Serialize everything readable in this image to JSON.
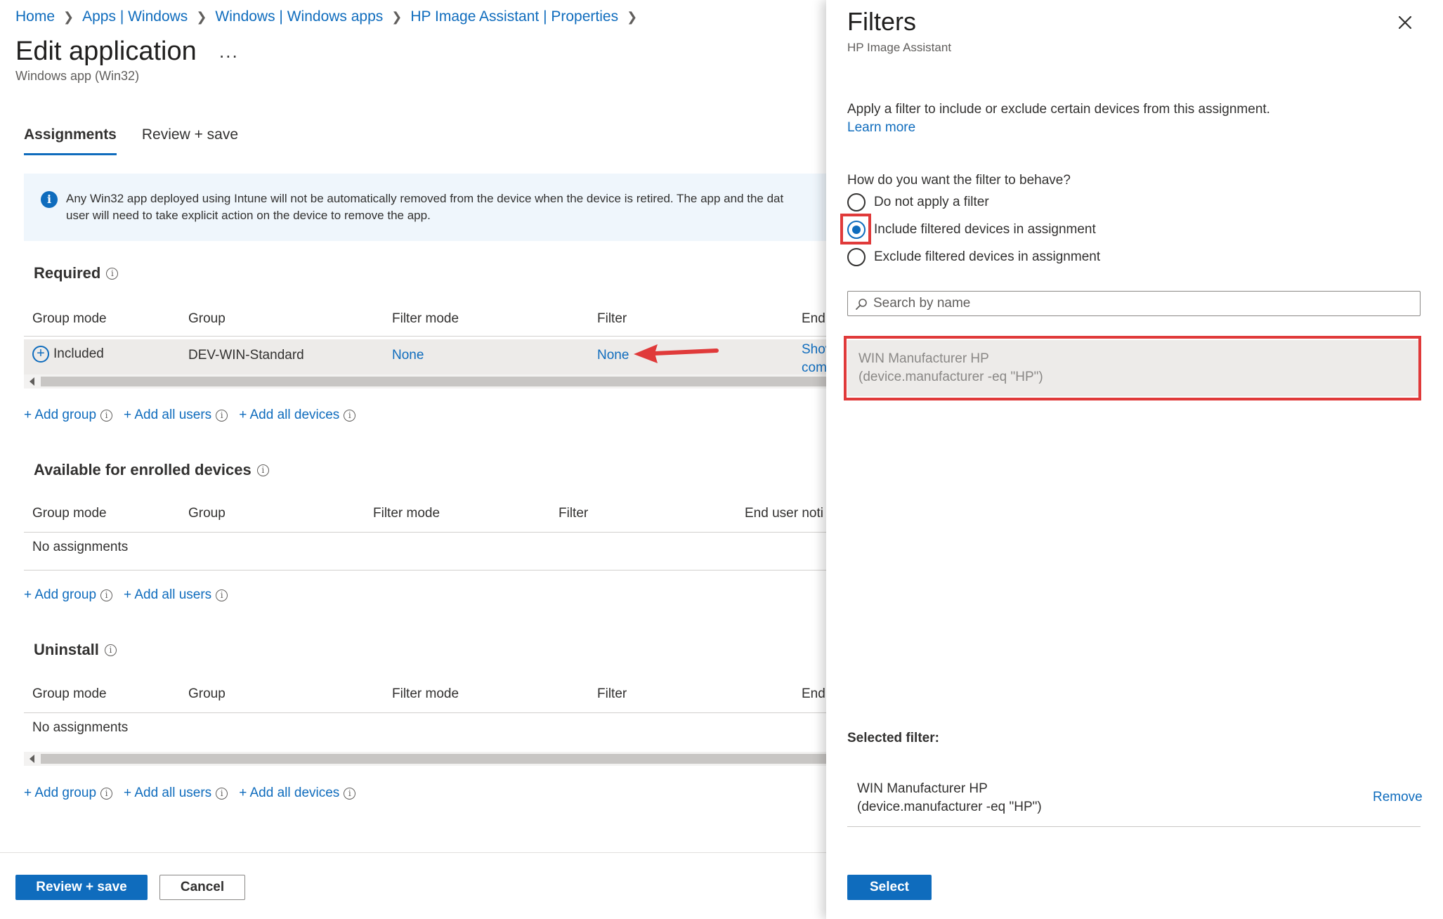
{
  "breadcrumb": [
    "Home",
    "Apps | Windows",
    "Windows | Windows apps",
    "HP Image Assistant | Properties"
  ],
  "page": {
    "title": "Edit application",
    "more_label": "...",
    "subtitle": "Windows app (Win32)"
  },
  "tabs": [
    "Assignments",
    "Review + save"
  ],
  "info_bar": {
    "line1": "Any Win32 app deployed using Intune will not be automatically removed from the device when the device is retired. The app and the dat",
    "line2": "user will need to take explicit action on the device to remove the app."
  },
  "required": {
    "title": "Required",
    "columns": [
      "Group mode",
      "Group",
      "Filter mode",
      "Filter",
      "End"
    ],
    "row": {
      "group_mode": "Included",
      "group": "DEV-WIN-Standard",
      "filter_mode": "None",
      "filter": "None",
      "end_line1": "Shov",
      "end_line2": "com"
    }
  },
  "available": {
    "title": "Available for enrolled devices",
    "columns": [
      "Group mode",
      "Group",
      "Filter mode",
      "Filter",
      "End user noti"
    ],
    "empty": "No assignments"
  },
  "uninstall": {
    "title": "Uninstall",
    "columns": [
      "Group mode",
      "Group",
      "Filter mode",
      "Filter",
      "End"
    ],
    "empty": "No assignments"
  },
  "add_links": {
    "add_group": "+ Add group",
    "add_all_users": "+ Add all users",
    "add_all_devices": "+ Add all devices"
  },
  "footer": {
    "review_save": "Review + save",
    "cancel": "Cancel"
  },
  "panel": {
    "title": "Filters",
    "subtitle": "HP Image Assistant",
    "description": "Apply a filter to include or exclude certain devices from this assignment.",
    "learn_more": "Learn more",
    "question": "How do you want the filter to behave?",
    "options": [
      "Do not apply a filter",
      "Include filtered devices in assignment",
      "Exclude filtered devices in assignment"
    ],
    "selected_option": "Include filtered devices in assignment",
    "search_placeholder": "Search by name",
    "filter_item": {
      "name": "WIN Manufacturer HP",
      "rule": "(device.manufacturer -eq \"HP\")"
    },
    "selected_label": "Selected filter:",
    "selected_filter": {
      "name": "WIN Manufacturer HP",
      "rule": "(device.manufacturer -eq \"HP\")"
    },
    "remove_label": "Remove",
    "select_button": "Select"
  },
  "colors": {
    "accent": "#0f6cbd",
    "annotation_red": "#e03a3a",
    "info_bg": "#eff6fc"
  }
}
